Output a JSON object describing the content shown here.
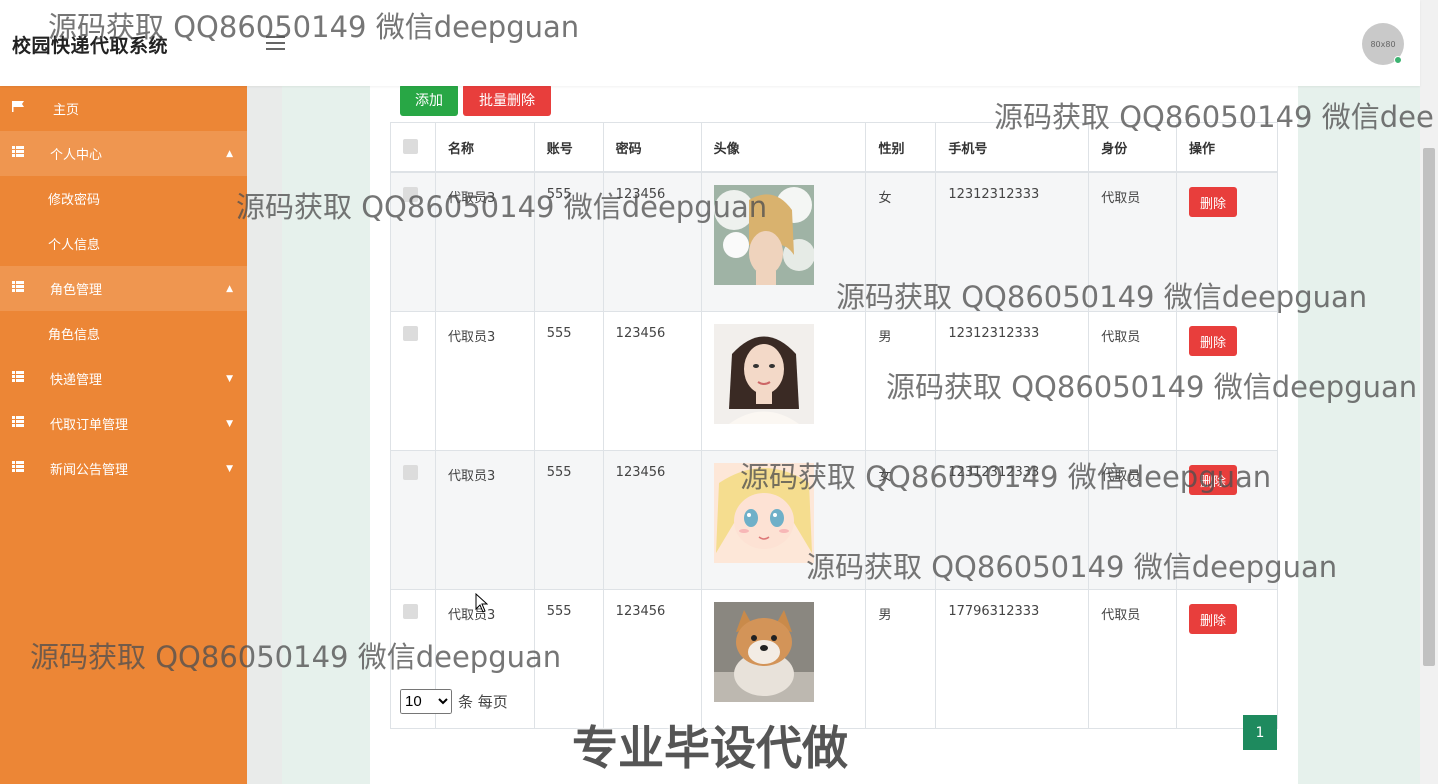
{
  "header": {
    "app_title": "校园快递代取系统",
    "avatar_text": "80x80"
  },
  "sidebar": {
    "items": [
      {
        "label": "主页",
        "icon": "flag-icon",
        "caret": ""
      },
      {
        "label": "个人中心",
        "icon": "grid-icon",
        "caret": "▲"
      },
      {
        "label": "修改密码"
      },
      {
        "label": "个人信息"
      },
      {
        "label": "角色管理",
        "icon": "grid-icon",
        "caret": "▲"
      },
      {
        "label": "角色信息"
      },
      {
        "label": "快递管理",
        "icon": "grid-icon",
        "caret": "▼"
      },
      {
        "label": "代取订单管理",
        "icon": "grid-icon",
        "caret": "▼"
      },
      {
        "label": "新闻公告管理",
        "icon": "grid-icon",
        "caret": "▼"
      }
    ]
  },
  "toolbar": {
    "add_label": "添加",
    "bulk_delete_label": "批量删除"
  },
  "table": {
    "headers": [
      "名称",
      "账号",
      "密码",
      "头像",
      "性别",
      "手机号",
      "身份",
      "操作"
    ],
    "rows": [
      {
        "name": "代取员3",
        "account": "555",
        "password": "123456",
        "gender": "女",
        "phone": "12312312333",
        "role": "代取员",
        "action": "删除",
        "avatar": "flowers-portrait"
      },
      {
        "name": "代取员3",
        "account": "555",
        "password": "123456",
        "gender": "男",
        "phone": "12312312333",
        "role": "代取员",
        "action": "删除",
        "avatar": "woman-portrait"
      },
      {
        "name": "代取员3",
        "account": "555",
        "password": "123456",
        "gender": "女",
        "phone": "12312312333",
        "role": "代取员",
        "action": "删除",
        "avatar": "anime-girl"
      },
      {
        "name": "代取员3",
        "account": "555",
        "password": "123456",
        "gender": "男",
        "phone": "17796312333",
        "role": "代取员",
        "action": "删除",
        "avatar": "shiba-dog"
      }
    ]
  },
  "pagination": {
    "page_size": "10",
    "page_size_suffix": "条 每页",
    "current_page": "1"
  },
  "watermarks": {
    "text": "源码获取 QQ86050149 微信deepguan",
    "text_cut": "源码获取 QQ86050149 微信dee",
    "big": "专业毕设代做"
  },
  "colors": {
    "sidebar": "#ec8636",
    "add": "#28a745",
    "danger": "#e83e3c",
    "page": "#1e8a5e"
  }
}
